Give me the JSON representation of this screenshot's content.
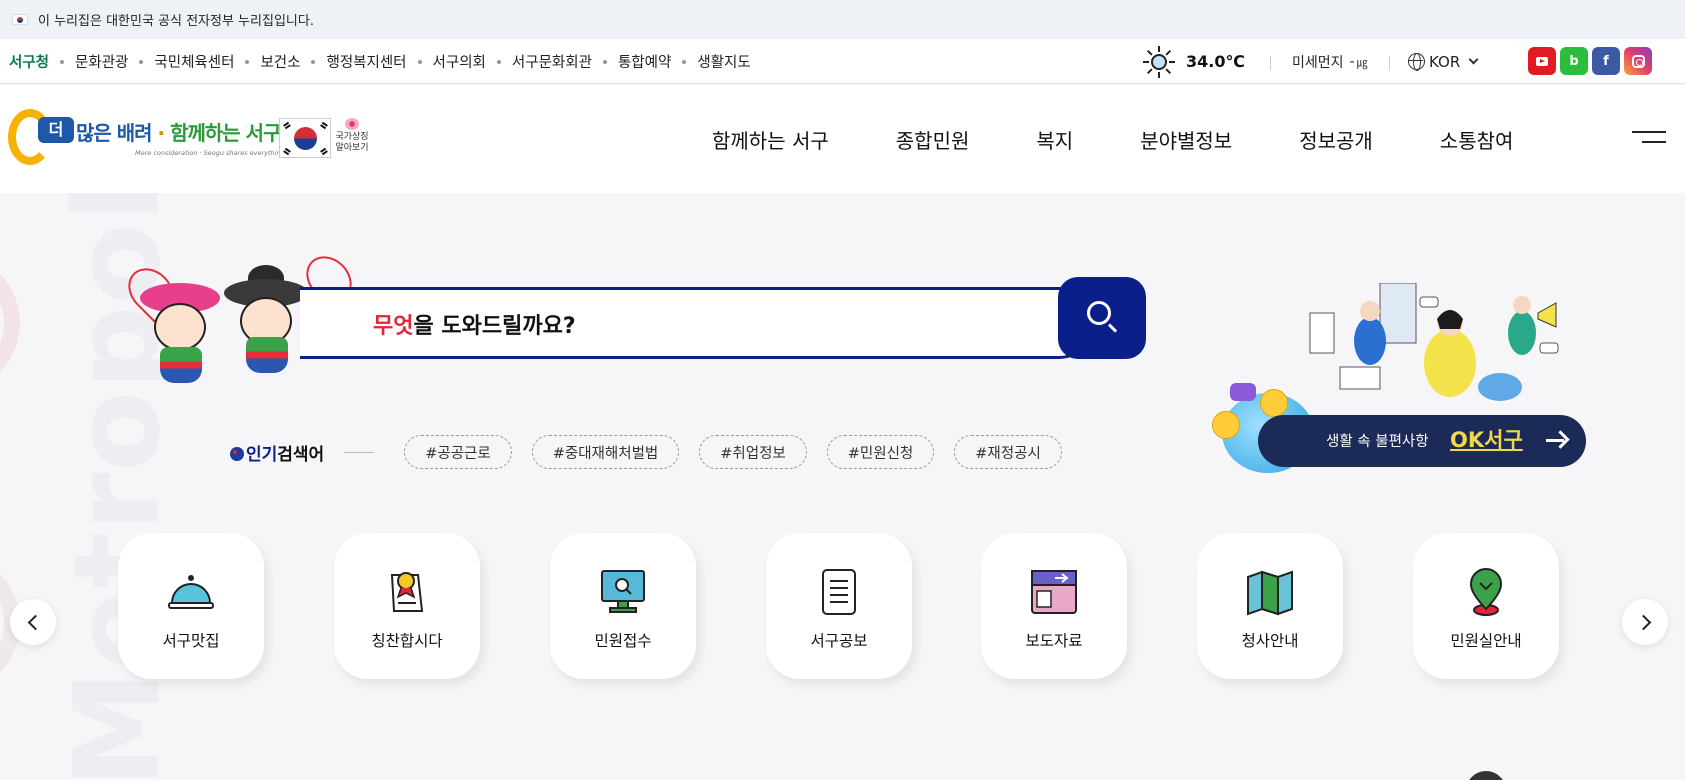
{
  "gov_banner": {
    "text": "이 누리집은 대한민국 공식 전자정부 누리집입니다.",
    "flag_icon": "korea-flag-icon"
  },
  "util_links": [
    "서구청",
    "문화관광",
    "국민체육센터",
    "보건소",
    "행정복지센터",
    "서구의회",
    "서구문화회관",
    "통합예약",
    "생활지도"
  ],
  "weather": {
    "temperature": "34.0℃",
    "icon": "sun-icon"
  },
  "dust": {
    "label": "미세먼지",
    "value": "-",
    "unit": "㎍"
  },
  "language": {
    "selected": "KOR"
  },
  "social": [
    {
      "name": "youtube",
      "color": "#e21b23"
    },
    {
      "name": "blog",
      "label": "b",
      "color": "#2bbd3c"
    },
    {
      "name": "facebook",
      "label": "f",
      "color": "#3b5aa3"
    },
    {
      "name": "instagram",
      "color": "#e33d6d"
    }
  ],
  "logo": {
    "badge": "더",
    "line_a": "많은 배려",
    "line_sep": " · ",
    "line_b": "함께하는 서구",
    "sub": "More consideration · Seogu shares everything"
  },
  "national_symbol": {
    "line1": "국가상징",
    "line2": "알아보기"
  },
  "gnb": [
    "함께하는 서구",
    "종합민원",
    "복지",
    "분야별정보",
    "정보공개",
    "소통참여"
  ],
  "background_word": "Metropolitan City",
  "search": {
    "highlight": "무엇",
    "rest": "을 도와드릴까요?"
  },
  "popular": {
    "title_a": "인기",
    "title_b": "검색어",
    "tags": [
      "#공공근로",
      "#중대재해처벌법",
      "#취업정보",
      "#민원신청",
      "#재정공시"
    ]
  },
  "ok_banner": {
    "text": "생활 속 불편사항",
    "highlight": "OK서구",
    "accent": "#f3d84a",
    "bg": "#1c2a57"
  },
  "quick_menu": [
    {
      "label": "서구맛집",
      "icon": "cloche-icon"
    },
    {
      "label": "칭찬합시다",
      "icon": "award-certificate-icon"
    },
    {
      "label": "민원접수",
      "icon": "monitor-search-icon"
    },
    {
      "label": "서구공보",
      "icon": "document-icon"
    },
    {
      "label": "보도자료",
      "icon": "press-release-icon"
    },
    {
      "label": "청사안내",
      "icon": "map-icon"
    },
    {
      "label": "민원실안내",
      "icon": "location-pin-icon"
    }
  ],
  "colors": {
    "primary_navy": "#0b1f8a",
    "accent_red": "#e3233a",
    "brand_green": "#0a7a56"
  }
}
